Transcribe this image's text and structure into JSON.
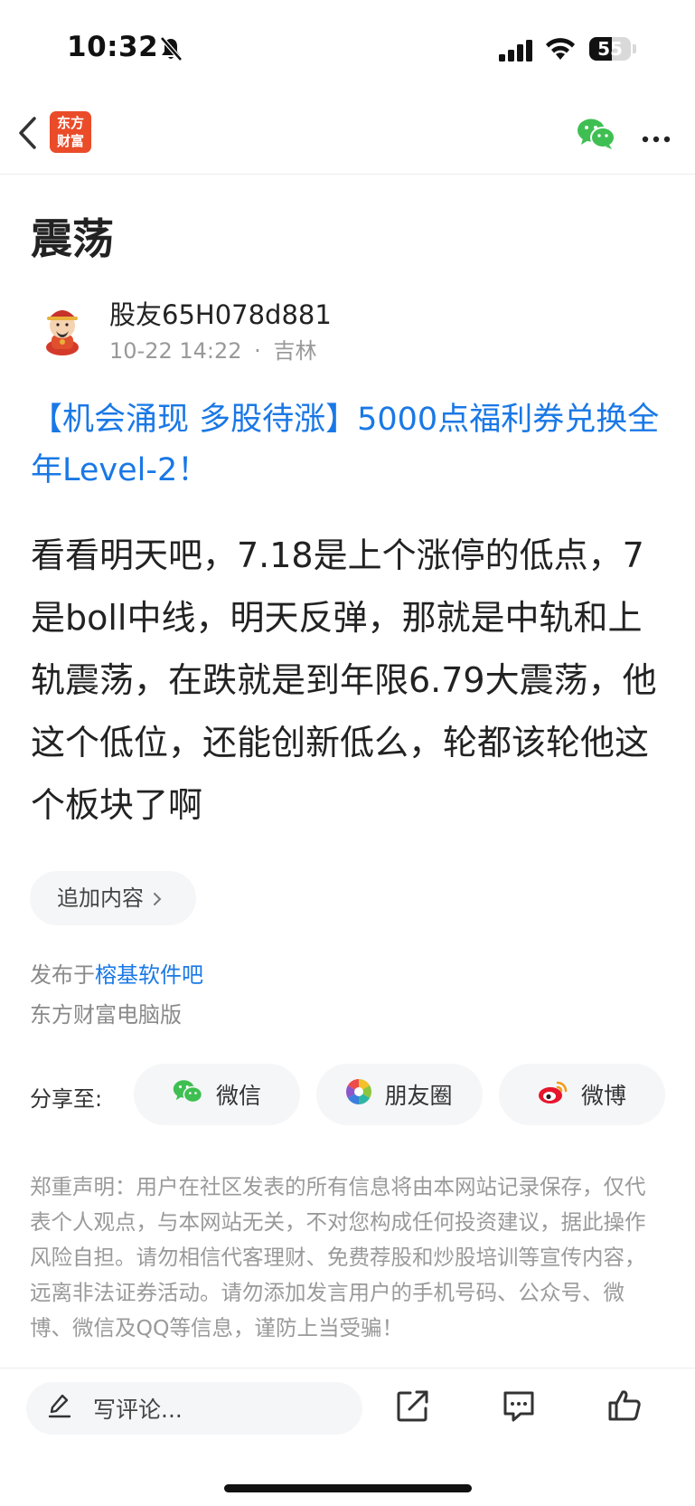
{
  "status_bar": {
    "time": "10:32",
    "battery": "55",
    "battery_level": 0.55
  },
  "nav": {
    "logo_line1": "东方",
    "logo_line2": "财富"
  },
  "article": {
    "title": "震荡",
    "author": "股友65H078d881",
    "date": "10-22 14:22",
    "separator": "·",
    "location": "吉林",
    "promo": "【机会涌现 多股待涨】5000点福利券兑换全年Level-2！",
    "body": "看看明天吧，7.18是上个涨停的低点，7是boll中线，明天反弹，那就是中轨和上轨震荡，在跌就是到年限6.79大震荡，他这个低位，还能创新低么，轮都该轮他这个板块了啊",
    "add_content": "追加内容",
    "published_prefix": "发布于",
    "published_forum": "榕基软件吧",
    "platform": "东方财富电脑版"
  },
  "share": {
    "label": "分享至:",
    "wechat": "微信",
    "moments": "朋友圈",
    "weibo": "微博"
  },
  "disclaimer": "郑重声明：用户在社区发表的所有信息将由本网站记录保存，仅代表个人观点，与本网站无关，不对您构成任何投资建议，据此操作风险自担。请勿相信代客理财、免费荐股和炒股培训等宣传内容，远离非法证券活动。请勿添加发言用户的手机号码、公众号、微博、微信及QQ等信息，谨防上当受骗！",
  "bottom_bar": {
    "comment_placeholder": "写评论..."
  },
  "colors": {
    "link_blue": "#1a78e6",
    "logo_red": "#ea4c2a",
    "wechat_green": "#3fbf52"
  }
}
